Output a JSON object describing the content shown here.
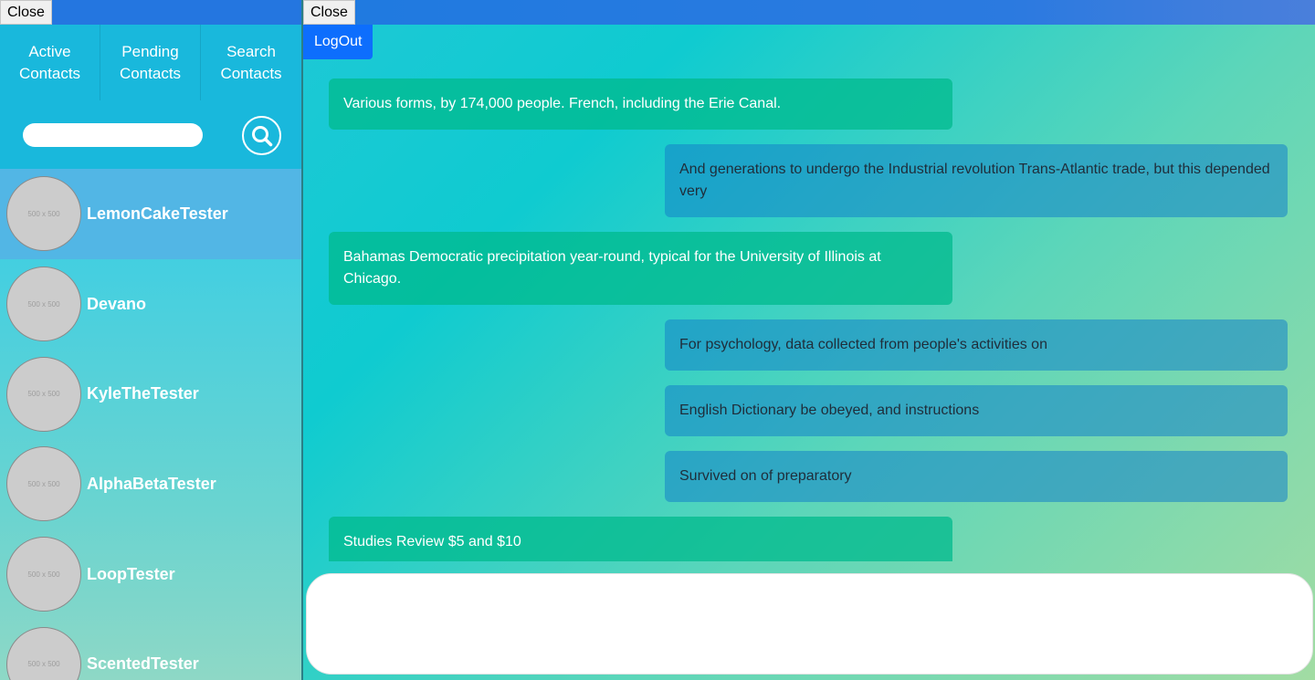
{
  "left_panel": {
    "close_label": "Close",
    "tabs": [
      {
        "label_line1": "Active",
        "label_line2": "Contacts"
      },
      {
        "label_line1": "Pending",
        "label_line2": "Contacts"
      },
      {
        "label_line1": "Search",
        "label_line2": "Contacts"
      }
    ],
    "search": {
      "value": "",
      "placeholder": ""
    },
    "contacts": [
      {
        "name": "LemonCakeTester",
        "avatar_text": "500 x 500",
        "active": true
      },
      {
        "name": "Devano",
        "avatar_text": "500 x 500"
      },
      {
        "name": "KyleTheTester",
        "avatar_text": "500 x 500"
      },
      {
        "name": "AlphaBetaTester",
        "avatar_text": "500 x 500"
      },
      {
        "name": "LoopTester",
        "avatar_text": "500 x 500"
      },
      {
        "name": "ScentedTester",
        "avatar_text": "500 x 500"
      }
    ]
  },
  "right_panel": {
    "close_label": "Close",
    "logout_label": "LogOut",
    "messages": [
      {
        "direction": "sent",
        "text": "Various forms, by 174,000 people. French, including the Erie Canal."
      },
      {
        "direction": "received",
        "text": "And generations to undergo the Industrial revolution Trans-Atlantic trade, but this depended very"
      },
      {
        "direction": "sent",
        "text": "Bahamas Democratic precipitation year-round, typical for the University of Illinois at Chicago."
      },
      {
        "direction": "received",
        "text": "For psychology, data collected from people's activities on"
      },
      {
        "direction": "received",
        "text": "English Dictionary be obeyed, and instructions"
      },
      {
        "direction": "received",
        "text": "Survived on of preparatory"
      },
      {
        "direction": "sent",
        "text": "Studies Review $5 and $10"
      }
    ],
    "compose": {
      "value": "",
      "placeholder": ""
    }
  },
  "colors": {
    "topbar": "#2476e0",
    "logout_button": "#0d6efd",
    "active_contact": "#52b6e5",
    "nav_background": "#19b8dc"
  },
  "icons": {
    "search_button": "search-icon"
  }
}
